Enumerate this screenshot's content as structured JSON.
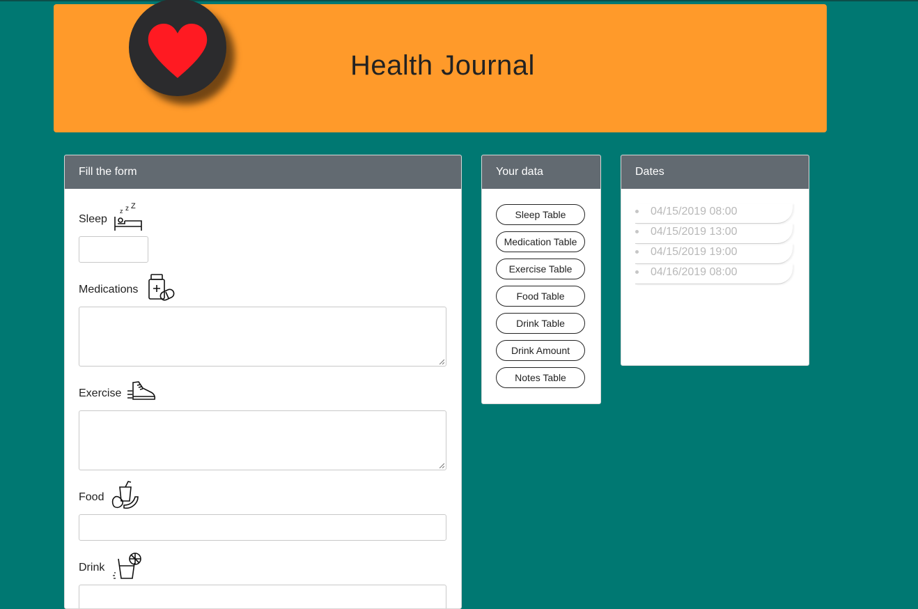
{
  "header": {
    "title": "Health Journal",
    "logo_icon": "heart-icon",
    "colors": {
      "page_bg": "#007872",
      "header_bg": "#ff9a2a",
      "logo_bg": "#2b2b2d",
      "heart": "#ff1a22",
      "card_header": "#626a71"
    }
  },
  "form": {
    "header": "Fill the form",
    "fields": [
      {
        "label": "Sleep",
        "icon": "bed-icon",
        "value": ""
      },
      {
        "label": "Medications",
        "icon": "pill-bottle-icon",
        "value": ""
      },
      {
        "label": "Exercise",
        "icon": "sneaker-icon",
        "value": ""
      },
      {
        "label": "Food",
        "icon": "food-icon",
        "value": ""
      },
      {
        "label": "Drink",
        "icon": "drink-icon",
        "value": ""
      }
    ]
  },
  "data_panel": {
    "header": "Your data",
    "buttons": [
      "Sleep Table",
      "Medication Table",
      "Exercise Table",
      "Food Table",
      "Drink Table",
      "Drink Amount",
      "Notes Table"
    ]
  },
  "dates_panel": {
    "header": "Dates",
    "dates": [
      "04/15/2019 08:00",
      "04/15/2019 13:00",
      "04/15/2019 19:00",
      "04/16/2019 08:00"
    ]
  }
}
